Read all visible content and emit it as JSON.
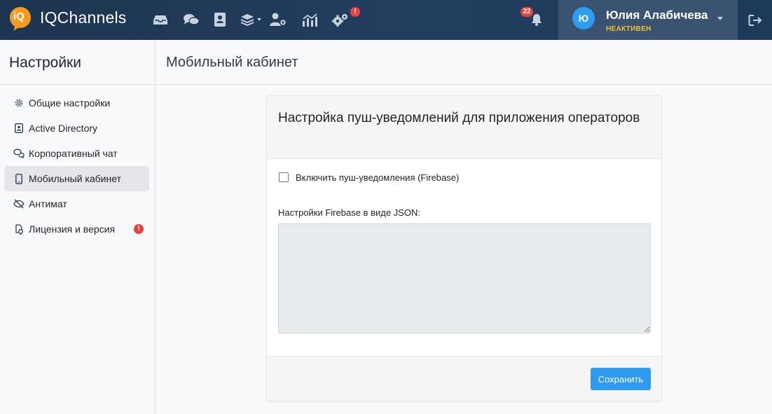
{
  "topbar": {
    "brand": "IQChannels",
    "logo_text": "iQ",
    "nav_icons": [
      "inbox-icon",
      "chats-icon",
      "contacts-icon",
      "layers-dropdown-icon",
      "users-settings-icon",
      "analytics-icon",
      "settings-icon"
    ],
    "settings_alert": "!",
    "notifications_count": "22",
    "user": {
      "initial": "Ю",
      "name": "Юлия Алабичева",
      "status": "НЕАКТИВЕН"
    },
    "colors": {
      "bar": "#1d3550",
      "badge": "#e8413f",
      "status": "#f1c232",
      "avatar": "#2d9cf1"
    }
  },
  "sidebar": {
    "title": "Настройки",
    "items": [
      {
        "label": "Общие настройки",
        "icon": "gear-icon"
      },
      {
        "label": "Active Directory",
        "icon": "contact-card-icon"
      },
      {
        "label": "Корпоративный чат",
        "icon": "chat-bubbles-icon"
      },
      {
        "label": "Мобильный кабинет",
        "icon": "mobile-phone-icon",
        "active": true
      },
      {
        "label": "Антимат",
        "icon": "eye-slash-icon"
      },
      {
        "label": "Лицензия и версия",
        "icon": "license-icon",
        "alert": "!"
      }
    ]
  },
  "main": {
    "page_title": "Мобильный кабинет",
    "card": {
      "title": "Настройка пуш-уведомлений для приложения операторов",
      "checkbox_label": "Включить пуш-уведомления (Firebase)",
      "checkbox_checked": false,
      "json_label": "Настройки Firebase в виде JSON:",
      "json_value": "",
      "save_label": "Сохранить"
    }
  }
}
